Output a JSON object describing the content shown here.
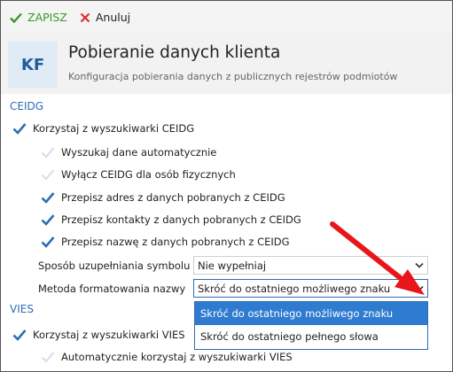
{
  "toolbar": {
    "save_label": "ZAPISZ",
    "cancel_label": "Anuluj"
  },
  "header": {
    "tile_text": "KF",
    "title": "Pobieranie danych klienta",
    "subtitle": "Konfiguracja pobierania danych z publicznych rejestrów podmiotów"
  },
  "ceidg": {
    "section_label": "CEIDG",
    "use_search": {
      "label": "Korzystaj z wyszukiwarki CEIDG",
      "checked": true
    },
    "options": [
      {
        "label": "Wyszukaj dane automatycznie",
        "checked": false
      },
      {
        "label": "Wyłącz CEIDG dla osób fizycznych",
        "checked": false
      },
      {
        "label": "Przepisz adres z danych pobranych z CEIDG",
        "checked": true
      },
      {
        "label": "Przepisz kontakty z danych pobranych z CEIDG",
        "checked": true
      },
      {
        "label": "Przepisz nazwę z danych pobranych z CEIDG",
        "checked": true
      }
    ],
    "symbol_fill": {
      "label": "Sposób uzupełniania symbolu",
      "value": "Nie wypełniaj"
    },
    "name_format": {
      "label": "Metoda formatowania nazwy",
      "value": "Skróć do ostatniego możliwego znaku",
      "options": [
        "Skróć do ostatniego możliwego znaku",
        "Skróć do ostatniego pełnego słowa"
      ],
      "selected_index": 0
    }
  },
  "vies": {
    "section_label": "VIES",
    "use_search": {
      "label": "Korzystaj z wyszukiwarki VIES",
      "checked": true
    },
    "auto_use": {
      "label": "Automatycznie korzystaj z wyszukiwarki VIES",
      "checked": false
    }
  },
  "colors": {
    "accent_blue": "#2d6db5",
    "save_green": "#3a9a26",
    "cancel_red": "#d9312b",
    "annotation_red": "#e8161b",
    "dropdown_highlight": "#2e7bd0"
  }
}
